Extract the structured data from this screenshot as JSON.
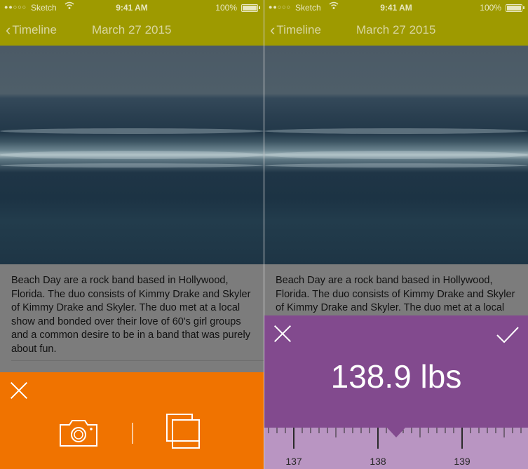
{
  "status_bar": {
    "signal": "●●○○○",
    "carrier": "Sketch",
    "time": "9:41 AM",
    "battery": "100%"
  },
  "nav": {
    "back_label": "Timeline",
    "title": "March 27 2015"
  },
  "article": {
    "text": "Beach Day are a rock band based in Hollywood, Florida. The duo consists of Kimmy Drake and Skyler of Kimmy Drake and Skyler. The duo met at a local show and bonded over their love of 60's girl groups and a common desire to be in a band that was purely about fun."
  },
  "colors": {
    "nav_bar": "#9e9a00",
    "orange_sheet": "#f07300",
    "purple_sheet": "#824a8e",
    "ruler": "#b995c2"
  },
  "left_sheet": {
    "icons": [
      "close-icon",
      "camera-icon",
      "gallery-icon"
    ]
  },
  "right_sheet": {
    "value": "138.9 lbs",
    "icons": [
      "close-icon",
      "check-icon"
    ],
    "ruler_labels": [
      "137",
      "138",
      "139"
    ]
  }
}
